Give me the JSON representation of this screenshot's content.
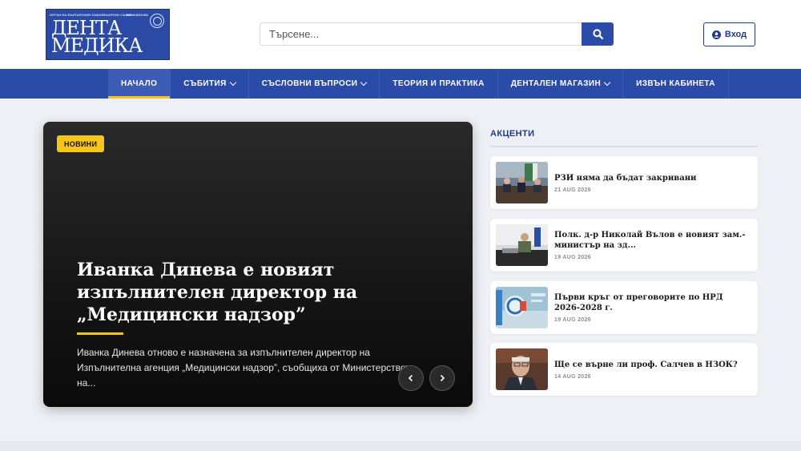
{
  "header": {
    "logo": {
      "line1": "ДЕНТА",
      "line2": "МЕДИКА",
      "tagline": "ОРГАН НА БЪЛГАРСКИЯ ЗЪБОЛЕКАРСКИ СЪЮЗ",
      "site": "WWW.BZS.BG"
    },
    "search": {
      "placeholder": "Търсене..."
    },
    "login_label": "Вход"
  },
  "nav": {
    "items": [
      {
        "label": "НАЧАЛО"
      },
      {
        "label": "СЪБИТИЯ"
      },
      {
        "label": "СЪСЛОВНИ ВЪПРОСИ"
      },
      {
        "label": "ТЕОРИЯ И ПРАКТИКА"
      },
      {
        "label": "ДЕНТАЛЕН МАГАЗИН"
      },
      {
        "label": "ИЗВЪН КАБИНЕТА"
      }
    ]
  },
  "hero": {
    "badge": "НОВИНИ",
    "title": "Иванка Динева е новият изпълнителен директор на „Медицински надзор”",
    "excerpt": "Иванка Динева отново е назначена за изпълнителен директор на Изпълнителна агенция „Медицински надзор”, съобщиха от Министерството на..."
  },
  "highlights": {
    "title": "АКЦЕНТИ",
    "items": [
      {
        "headline": "РЗИ няма да бъдат закривани",
        "date": "21 AUG 2026"
      },
      {
        "headline": "Полк. д-р Николай Вълов е новият зам.-министър на зд...",
        "date": "19 AUG 2026"
      },
      {
        "headline": "Първи кръг от преговорите по НРД 2026-2028 г.",
        "date": "19 AUG 2026"
      },
      {
        "headline": "Ще се върне ли проф. Салчев в НЗОК?",
        "date": "14 AUG 2026"
      }
    ]
  },
  "colors": {
    "brand_blue": "#2b4ba8",
    "accent_yellow": "#f5c518",
    "highlight_title": "#1f3a8a"
  }
}
